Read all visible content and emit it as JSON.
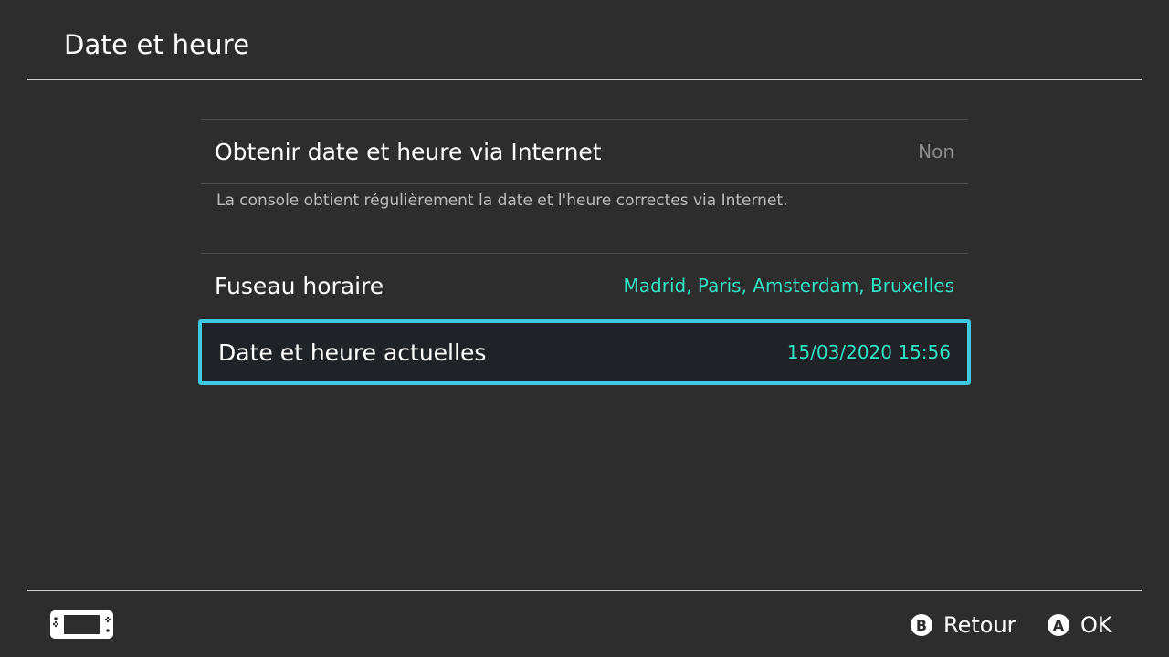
{
  "header": {
    "title": "Date et heure"
  },
  "settings": {
    "internet_sync": {
      "label": "Obtenir date et heure via Internet",
      "value": "Non",
      "description": "La console obtient régulièrement la date et l'heure correctes via Internet."
    },
    "timezone": {
      "label": "Fuseau horaire",
      "value": "Madrid, Paris, Amsterdam, Bruxelles"
    },
    "current_datetime": {
      "label": "Date et heure actuelles",
      "value": "15/03/2020 15:56"
    }
  },
  "footer": {
    "console_icon": "handheld-console-icon",
    "back": {
      "button": "B",
      "label": "Retour"
    },
    "ok": {
      "button": "A",
      "label": "OK"
    }
  },
  "colors": {
    "background": "#2d2d2d",
    "accent_value": "#30e3c4",
    "selection_border": "#3fc8e2",
    "selection_bg": "#1f2226"
  }
}
